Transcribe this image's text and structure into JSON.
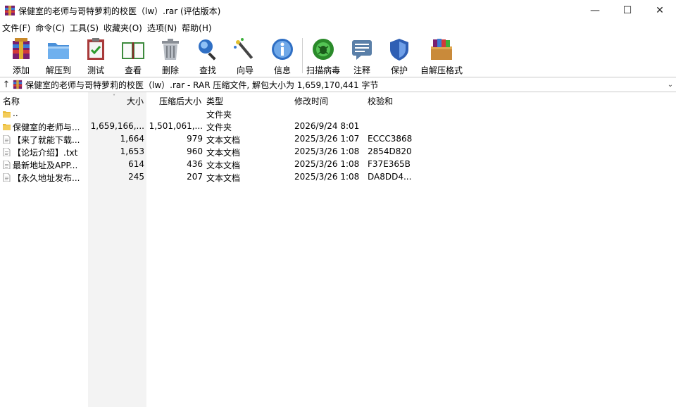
{
  "window": {
    "title": "保健室的老师与哥特萝莉的校医（lw）.rar (评估版本)",
    "controls": {
      "minimize": "—",
      "maximize": "☐",
      "close": "✕"
    }
  },
  "menu": [
    {
      "label": "文件(F)"
    },
    {
      "label": "命令(C)"
    },
    {
      "label": "工具(S)"
    },
    {
      "label": "收藏夹(O)"
    },
    {
      "label": "选项(N)"
    },
    {
      "label": "帮助(H)"
    }
  ],
  "toolbar": [
    {
      "label": "添加",
      "icon": "add-archive-icon"
    },
    {
      "label": "解压到",
      "icon": "extract-folder-icon"
    },
    {
      "label": "测试",
      "icon": "test-clipboard-icon"
    },
    {
      "label": "查看",
      "icon": "view-book-icon"
    },
    {
      "label": "删除",
      "icon": "trash-icon"
    },
    {
      "label": "查找",
      "icon": "magnifier-icon"
    },
    {
      "label": "向导",
      "icon": "wizard-wand-icon"
    },
    {
      "label": "信息",
      "icon": "info-icon"
    },
    {
      "label": "扫描病毒",
      "icon": "virus-scan-icon"
    },
    {
      "label": "注释",
      "icon": "comment-icon"
    },
    {
      "label": "保护",
      "icon": "shield-icon"
    },
    {
      "label": "自解压格式",
      "icon": "sfx-box-icon"
    }
  ],
  "address": {
    "text": "保健室的老师与哥特萝莉的校医（lw）.rar - RAR 压缩文件, 解包大小为 1,659,170,441 字节"
  },
  "columns": {
    "name": "名称",
    "size": "大小",
    "packed": "压缩后大小",
    "type": "类型",
    "modified": "修改时间",
    "crc": "校验和"
  },
  "files": [
    {
      "name": "..",
      "size": "",
      "packed": "",
      "type": "文件夹",
      "modified": "",
      "crc": "",
      "kind": "folder"
    },
    {
      "name": "保健室的老师与...",
      "size": "1,659,166,...",
      "packed": "1,501,061,...",
      "type": "文件夹",
      "modified": "2026/9/24 8:01",
      "crc": "",
      "kind": "folder"
    },
    {
      "name": "【来了就能下载...",
      "size": "1,664",
      "packed": "979",
      "type": "文本文档",
      "modified": "2025/3/26 1:07",
      "crc": "ECCC3868",
      "kind": "file"
    },
    {
      "name": "【论坛介绍】.txt",
      "size": "1,653",
      "packed": "960",
      "type": "文本文档",
      "modified": "2025/3/26 1:08",
      "crc": "2854D820",
      "kind": "file"
    },
    {
      "name": "最新地址及APP...",
      "size": "614",
      "packed": "436",
      "type": "文本文档",
      "modified": "2025/3/26 1:08",
      "crc": "F37E365B",
      "kind": "file"
    },
    {
      "name": "【永久地址发布...",
      "size": "245",
      "packed": "207",
      "type": "文本文档",
      "modified": "2025/3/26 1:08",
      "crc": "DA8DD4...",
      "kind": "file"
    }
  ]
}
